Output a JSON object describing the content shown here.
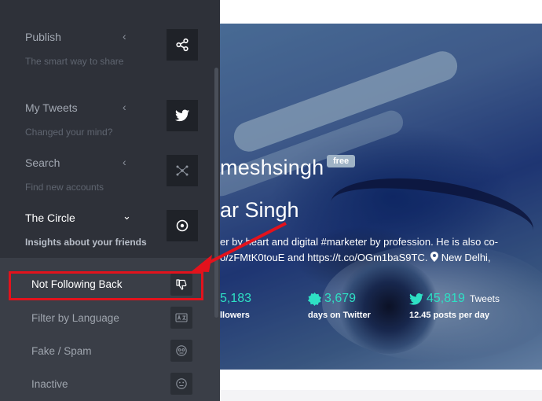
{
  "sidebar": {
    "items": [
      {
        "label": "Publish",
        "subtitle": "The smart way to share",
        "icon": "share-icon",
        "expanded": false
      },
      {
        "label": "My Tweets",
        "subtitle": "Changed your mind?",
        "icon": "twitter-icon",
        "expanded": false
      },
      {
        "label": "Search",
        "subtitle": "Find new accounts",
        "icon": "network-icon",
        "expanded": false
      },
      {
        "label": "The Circle",
        "subtitle": "Insights about your friends",
        "icon": "target-icon",
        "expanded": true
      }
    ],
    "subitems": [
      {
        "label": "Not Following Back",
        "icon": "thumbs-down-icon",
        "highlighted": true
      },
      {
        "label": "Filter by Language",
        "icon": "language-icon",
        "highlighted": false
      },
      {
        "label": "Fake / Spam",
        "icon": "spam-face-icon",
        "highlighted": false
      },
      {
        "label": "Inactive",
        "icon": "neutral-face-icon",
        "highlighted": false
      }
    ]
  },
  "profile": {
    "username": "meshsingh",
    "badge": "free",
    "fullname": "ar Singh",
    "bio_lines": [
      "er by heart and digital #marketer by profession. He is also co-",
      "o/zFMtK0touE and https://t.co/OGm1baS9TC."
    ],
    "location": "New Delhi,",
    "stats": [
      {
        "value": "5,183",
        "unit": "",
        "label": "llowers",
        "icon": "none"
      },
      {
        "value": "3,679",
        "unit": "",
        "label": "days on Twitter",
        "icon": "badge-icon"
      },
      {
        "value": "45,819",
        "unit": "Tweets",
        "label": "12.45 posts per day",
        "icon": "twitter-icon"
      }
    ]
  },
  "colors": {
    "sidebar_bg": "#2e3139",
    "accent_teal": "#2ee0c4",
    "highlight_red": "#e3121c"
  }
}
